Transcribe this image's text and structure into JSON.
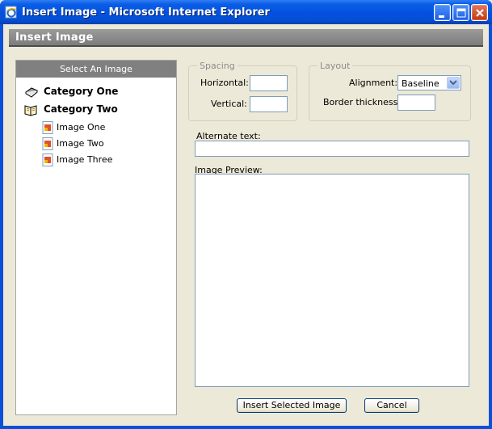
{
  "window": {
    "title": "Insert Image - Microsoft Internet Explorer"
  },
  "header": {
    "title": "Insert Image"
  },
  "image_list": {
    "heading": "Select An Image",
    "categories": [
      {
        "label": "Category One",
        "icon": "closed-book-icon"
      },
      {
        "label": "Category Two",
        "icon": "open-book-icon",
        "images": [
          "Image One",
          "Image Two",
          "Image Three"
        ]
      }
    ]
  },
  "spacing": {
    "legend": "Spacing",
    "horizontal_label": "Horizontal:",
    "horizontal_value": "",
    "vertical_label": "Vertical:",
    "vertical_value": ""
  },
  "layout": {
    "legend": "Layout",
    "alignment_label": "Alignment:",
    "alignment_value": "Baseline",
    "border_label": "Border thickness:",
    "border_value": ""
  },
  "alt_text": {
    "label": "Alternate text:",
    "value": ""
  },
  "preview": {
    "label": "Image Preview:"
  },
  "buttons": {
    "insert": "Insert Selected Image",
    "cancel": "Cancel"
  },
  "colors": {
    "titlebar": "#0a5ee6",
    "header_bar": "#808080",
    "dialog_bg": "#ece9d8"
  }
}
